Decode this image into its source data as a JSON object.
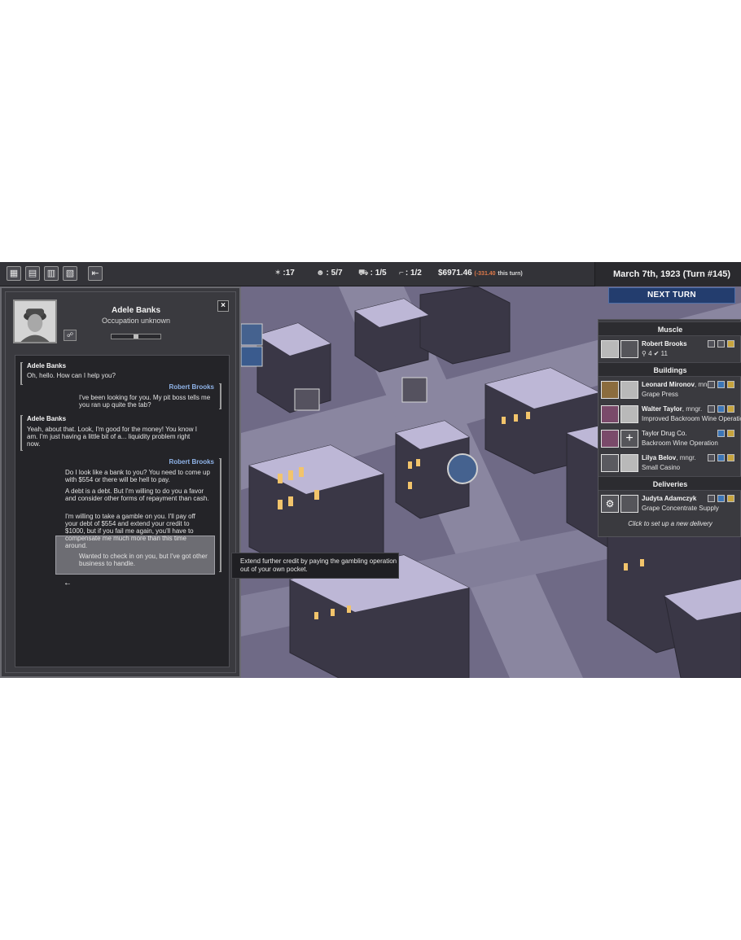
{
  "topbar": {
    "stats": [
      {
        "icon": "muscle-icon",
        "value": "17"
      },
      {
        "icon": "people-icon",
        "value": "5/7"
      },
      {
        "icon": "truck-icon",
        "value": "1/5"
      },
      {
        "icon": "gun-icon",
        "value": "1/2"
      }
    ],
    "money": "$6971.46",
    "money_delta": "(-331.40",
    "money_suffix": "this turn)",
    "date": "March 7th, 1923  (Turn #145)",
    "next_turn": "NEXT TURN"
  },
  "dialog": {
    "name": "Adele Banks",
    "occupation": "Occupation unknown",
    "relationship_level": 0.5,
    "close": "×",
    "messages": [
      {
        "speaker": "Adele Banks",
        "text": "Oh, hello. How can I help you?"
      },
      {
        "speaker": "Robert Brooks",
        "text": "I've been looking for you. My pit boss tells me you ran up quite the tab?"
      },
      {
        "speaker": "Adele Banks",
        "text": "Yeah, about that. Look, I'm good for the money! You know I am. I'm just having a little bit of a... liquidity problem right now."
      },
      {
        "speaker": "Robert Brooks",
        "text": ""
      }
    ],
    "options": [
      "Do I look like a bank to you? You need to come up with $554 or there will be hell to pay.",
      "A debt is a debt. But I'm willing to do you a favor and consider other forms of repayment than cash.",
      "I'm willing to take a gamble on you. I'll pay off your debt of $554 and extend your credit to $1000, but if you fail me again, you'll have to compensate me much more than this time around.",
      "Wanted to check in on you, but I've got other business to handle."
    ],
    "back": "←"
  },
  "tooltip": "Extend further credit by paying the gambling operation out of your own pocket.",
  "sidebar": {
    "sections": {
      "muscle": "Muscle",
      "buildings": "Buildings",
      "deliveries": "Deliveries"
    },
    "muscle": {
      "name": "Robert Brooks",
      "stats": "⚲ 4  ✔ 11"
    },
    "buildings": [
      {
        "name": "Leonard Mironov",
        "suffix": ", mngr.",
        "sub": "Grape Press"
      },
      {
        "name": "Walter Taylor",
        "suffix": ", mngr.",
        "sub": "Improved Backroom Wine Operation"
      },
      {
        "name": "",
        "suffix": "",
        "sub": "Taylor Drug Co.",
        "sub2": "Backroom Wine Operation"
      },
      {
        "name": "Lilya Belov",
        "suffix": ", mngr.",
        "sub": "Small Casino"
      }
    ],
    "delivery": {
      "name": "Judyta Adamczyk",
      "sub": "Grape Concentrate Supply"
    },
    "setup": "Click to set up a new delivery"
  }
}
